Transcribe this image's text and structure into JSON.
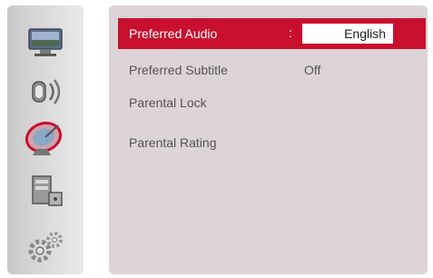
{
  "sidebar": {
    "items": [
      {
        "icon": "display-icon"
      },
      {
        "icon": "speaker-icon"
      },
      {
        "icon": "satellite-dish-icon",
        "selected": true
      },
      {
        "icon": "lock-cabinet-icon"
      },
      {
        "icon": "gears-icon"
      }
    ]
  },
  "menu": {
    "rows": [
      {
        "label": "Preferred Audio",
        "separator": ":",
        "value": "English",
        "selected": true
      },
      {
        "label": "Preferred Subtitle",
        "value": "Off"
      },
      {
        "label": "Parental Lock"
      },
      {
        "label": "Parental Rating"
      }
    ]
  },
  "colors": {
    "accent": "#c8102e",
    "panel": "#dcd4d6",
    "sidebar": "#d6d6d6"
  }
}
